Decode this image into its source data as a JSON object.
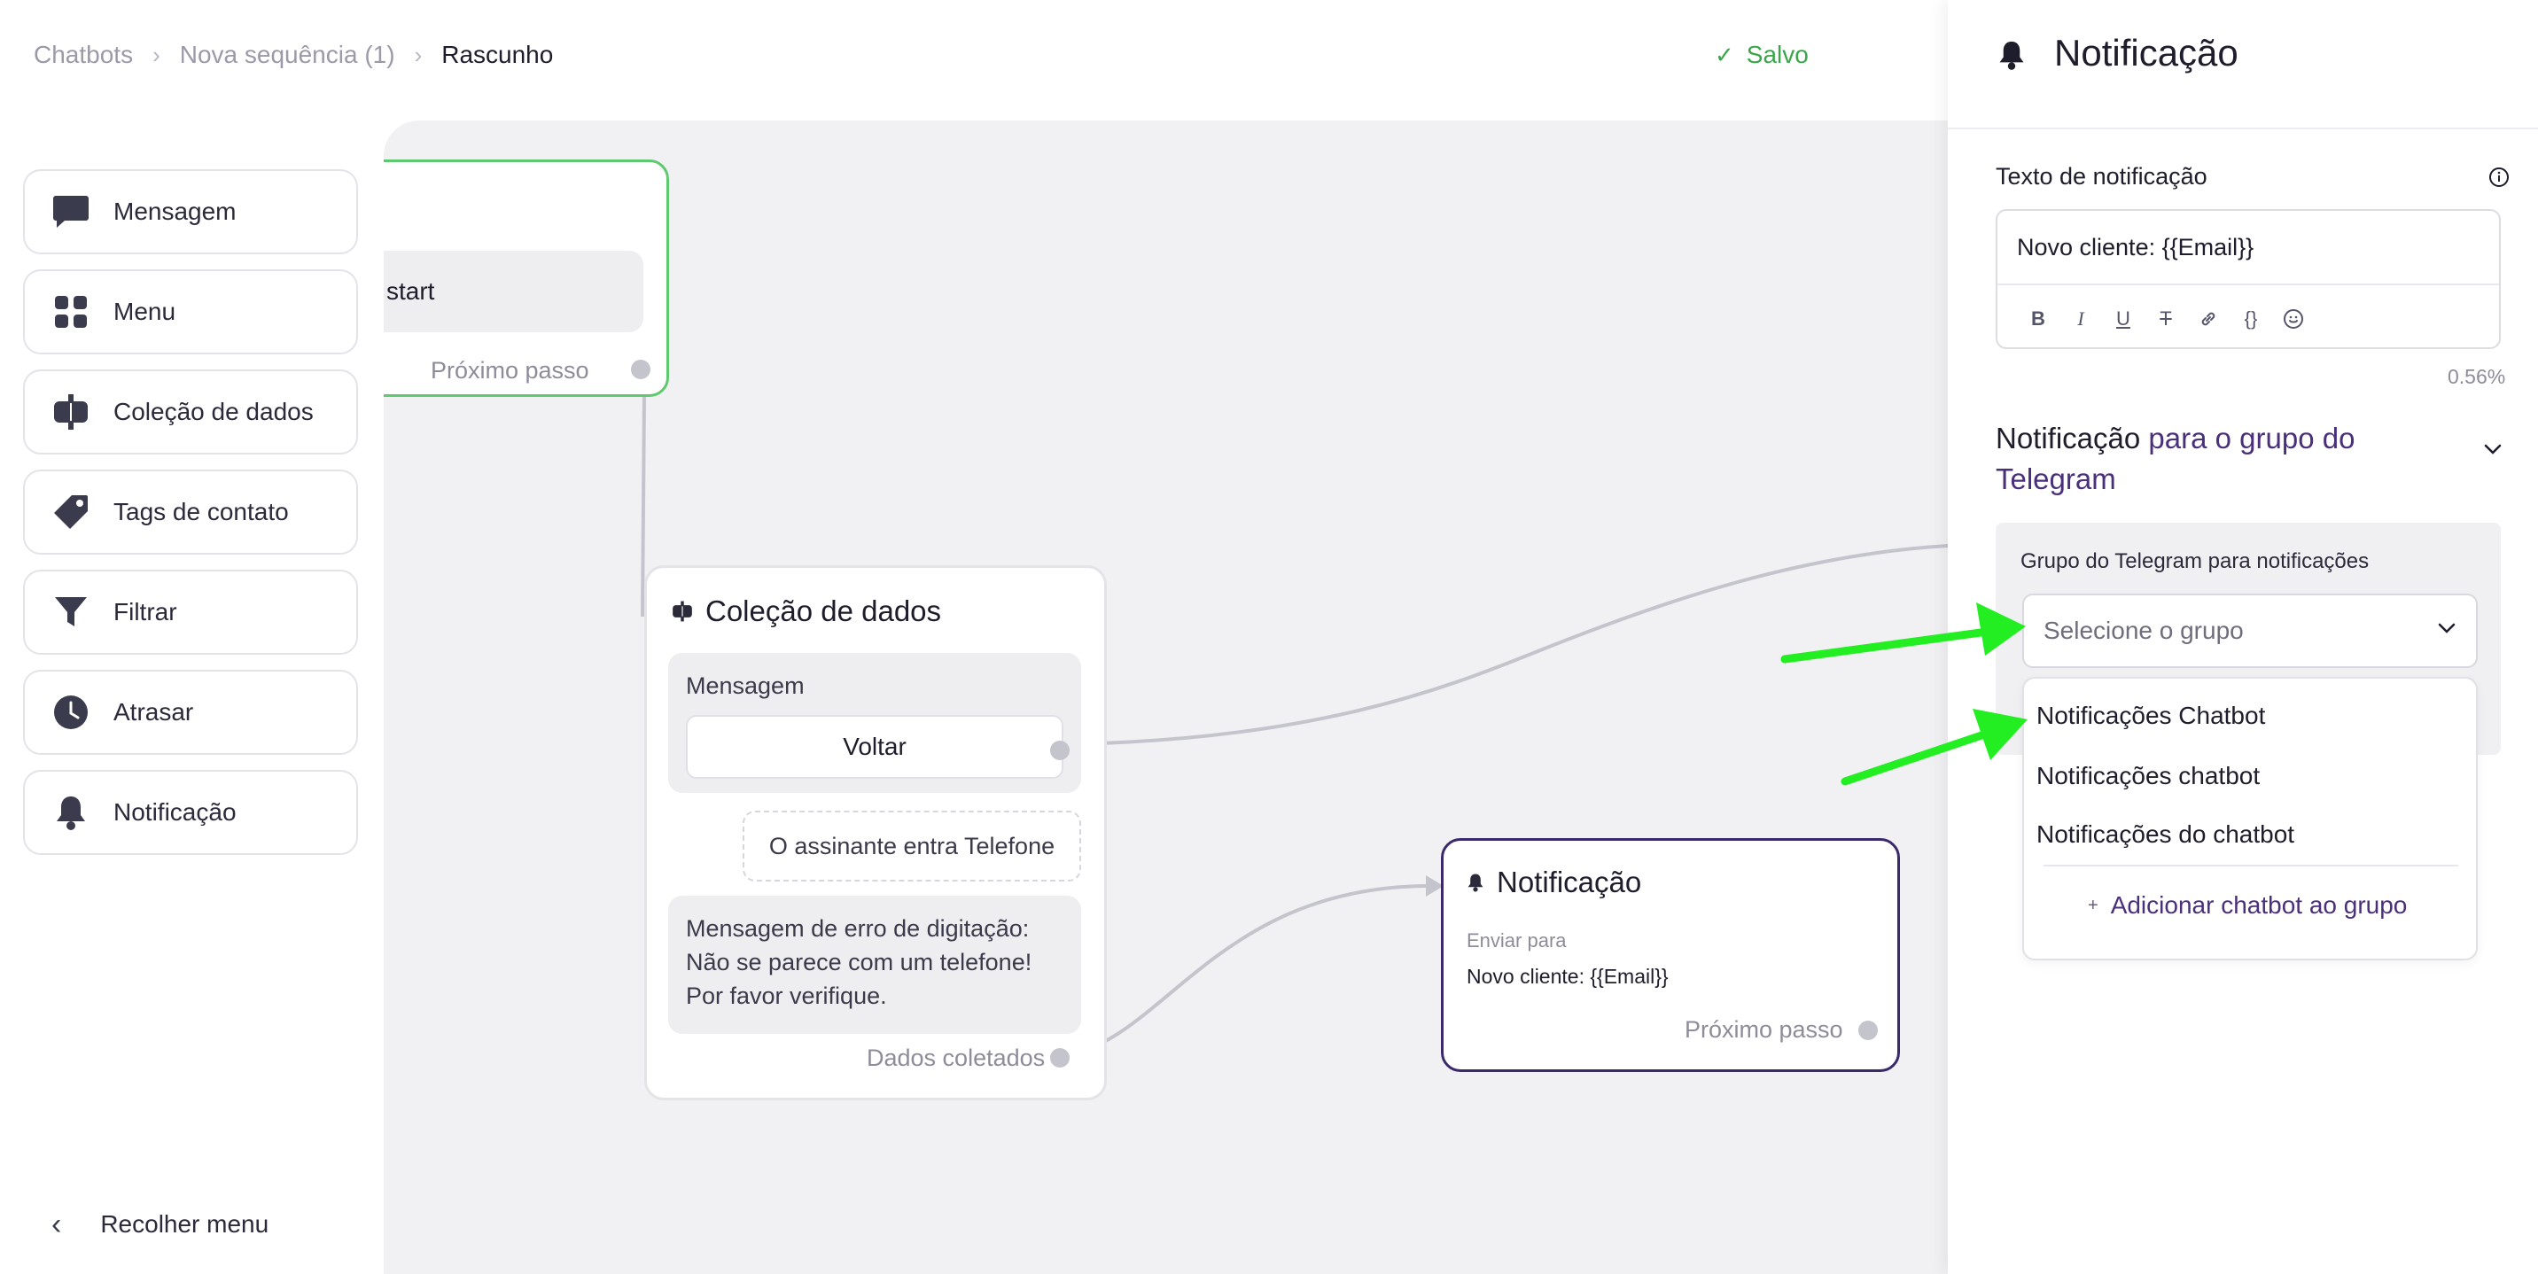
{
  "breadcrumb": {
    "items": [
      "Chatbots",
      "Nova sequência (1)",
      "Rascunho"
    ],
    "separator": "›"
  },
  "status": {
    "saved_label": "Salvo"
  },
  "sidebar": {
    "items": [
      {
        "label": "Mensagem",
        "icon": "message-icon"
      },
      {
        "label": "Menu",
        "icon": "grid-icon"
      },
      {
        "label": "Coleção de dados",
        "icon": "data-collection-icon"
      },
      {
        "label": "Tags de contato",
        "icon": "tag-icon"
      },
      {
        "label": "Filtrar",
        "icon": "filter-icon"
      },
      {
        "label": "Atrasar",
        "icon": "clock-icon"
      },
      {
        "label": "Notificação",
        "icon": "bell-icon"
      }
    ],
    "collapse_label": "Recolher menu"
  },
  "canvas": {
    "start_node": {
      "chip_text": "start",
      "next_label": "Próximo passo"
    },
    "data_node": {
      "title": "Coleção de dados",
      "message_label": "Mensagem",
      "button_label": "Voltar",
      "input_text": "O assinante entra Telefone",
      "error_lines": [
        "Mensagem de erro de digitação:",
        "Não se parece com um telefone!",
        "Por favor verifique."
      ],
      "collected_label": "Dados coletados"
    },
    "notification_node": {
      "title": "Notificação",
      "send_to_label": "Enviar para",
      "send_to_value": "Novo cliente: {{Email}}",
      "next_label": "Próximo passo"
    }
  },
  "panel": {
    "title": "Notificação",
    "text_label": "Texto de notificação",
    "text_value": "Novo cliente: {{Email}}",
    "toolbar": [
      "B",
      "I",
      "U",
      "T",
      "link",
      "{}",
      "emoji"
    ],
    "percent": "0.56%",
    "section_title_plain": "Notificação ",
    "section_title_accent": "para o grupo do Telegram",
    "group_label": "Grupo do Telegram para notificações",
    "select_placeholder": "Selecione o grupo",
    "options": [
      "Notificações Chatbot",
      "Notificações chatbot",
      "Notificações do chatbot"
    ],
    "add_label": "Adicionar chatbot ao grupo"
  },
  "colors": {
    "accent": "#4a2f7a",
    "saved": "#3aa64a",
    "start_border": "#5fc970",
    "annotation_arrow": "#22ee22"
  }
}
